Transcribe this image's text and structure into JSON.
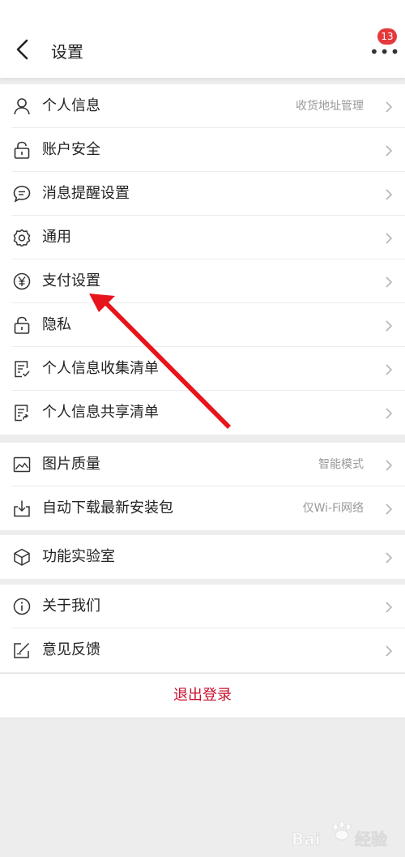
{
  "header": {
    "title": "设置",
    "badge_count": "13"
  },
  "groups": [
    {
      "items": [
        {
          "label": "个人信息",
          "value": "收货地址管理",
          "icon": "person-icon"
        },
        {
          "label": "账户安全",
          "value": "",
          "icon": "lock-icon"
        },
        {
          "label": "消息提醒设置",
          "value": "",
          "icon": "message-icon"
        },
        {
          "label": "通用",
          "value": "",
          "icon": "gear-icon"
        },
        {
          "label": "支付设置",
          "value": "",
          "icon": "yen-icon"
        },
        {
          "label": "隐私",
          "value": "",
          "icon": "lock-icon"
        },
        {
          "label": "个人信息收集清单",
          "value": "",
          "icon": "document-list-icon"
        },
        {
          "label": "个人信息共享清单",
          "value": "",
          "icon": "document-share-icon"
        }
      ]
    },
    {
      "items": [
        {
          "label": "图片质量",
          "value": "智能模式",
          "icon": "image-icon"
        },
        {
          "label": "自动下载最新安装包",
          "value": "仅Wi-Fi网络",
          "icon": "download-icon"
        }
      ]
    },
    {
      "items": [
        {
          "label": "功能实验室",
          "value": "",
          "icon": "cube-icon"
        }
      ]
    },
    {
      "items": [
        {
          "label": "关于我们",
          "value": "",
          "icon": "info-icon"
        },
        {
          "label": "意见反馈",
          "value": "",
          "icon": "feedback-icon"
        }
      ]
    }
  ],
  "logout_label": "退出登录",
  "watermark_text": "Baidu经验",
  "colors": {
    "accent": "#c8102e",
    "badge": "#e4393c",
    "arrow": "#e8141b",
    "background": "#ededed"
  }
}
